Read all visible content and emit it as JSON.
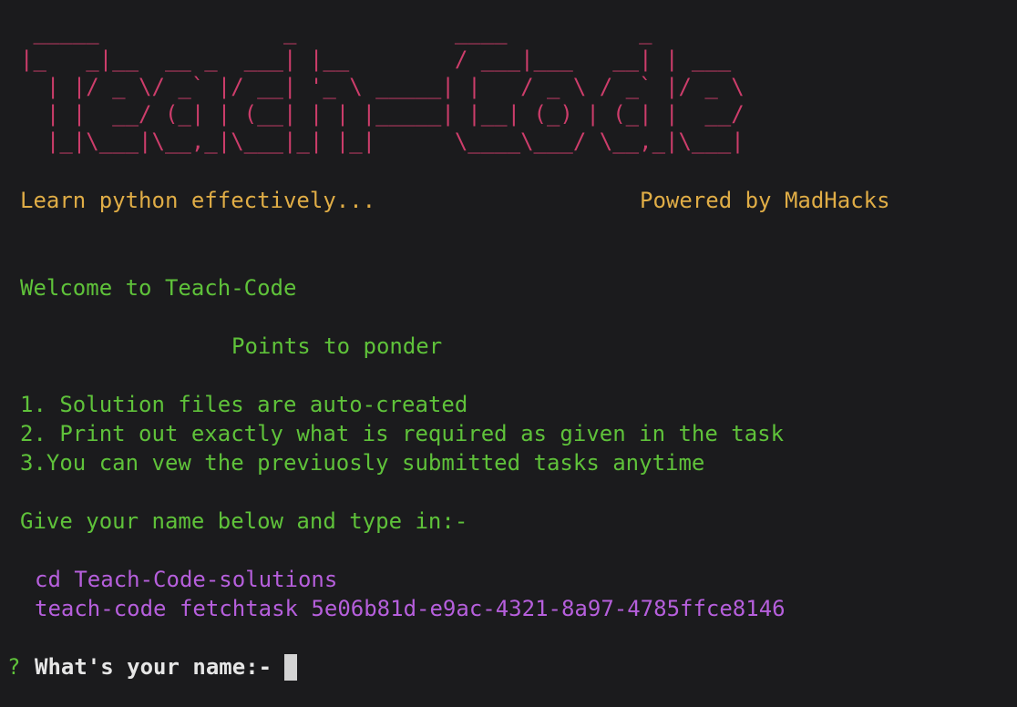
{
  "banner": {
    "ascii_art": " _____              _            ____          _\n|_   _|__  __ _  ___| |__        / ___|___   __| | ___\n  | |/ _ \\/ _` |/ __| '_ \\ _____| |   / _ \\ / _` |/ _ \\\n  | |  __/ (_| | (__| | | |_____| |__| (_) | (_| |  __/\n  |_|\\___|\\__,_|\\___|_| |_|      \\____\\___/ \\__,_|\\___|",
    "color": "#cd3d6b"
  },
  "tagline": {
    "left": "Learn python effectively...",
    "right": "Powered by MadHacks",
    "color": "#e0ad46"
  },
  "welcome": "Welcome to Teach-Code",
  "points_heading": "Points to ponder",
  "points": [
    "1. Solution files are auto-created",
    "2. Print out exactly what is required as given in the task",
    "3.You can vew the previuosly submitted tasks anytime"
  ],
  "instruction": "Give your name below and type in:-",
  "commands": [
    "cd Teach-Code-solutions",
    "teach-code fetchtask 5e06b81d-e9ac-4321-8a97-4785ffce8146"
  ],
  "prompt": {
    "symbol": "?",
    "question": "What's your name:-"
  },
  "colors": {
    "background": "#1b1b1d",
    "green": "#5fc23a",
    "purple": "#b65fdc",
    "white": "#e6e6e6"
  }
}
